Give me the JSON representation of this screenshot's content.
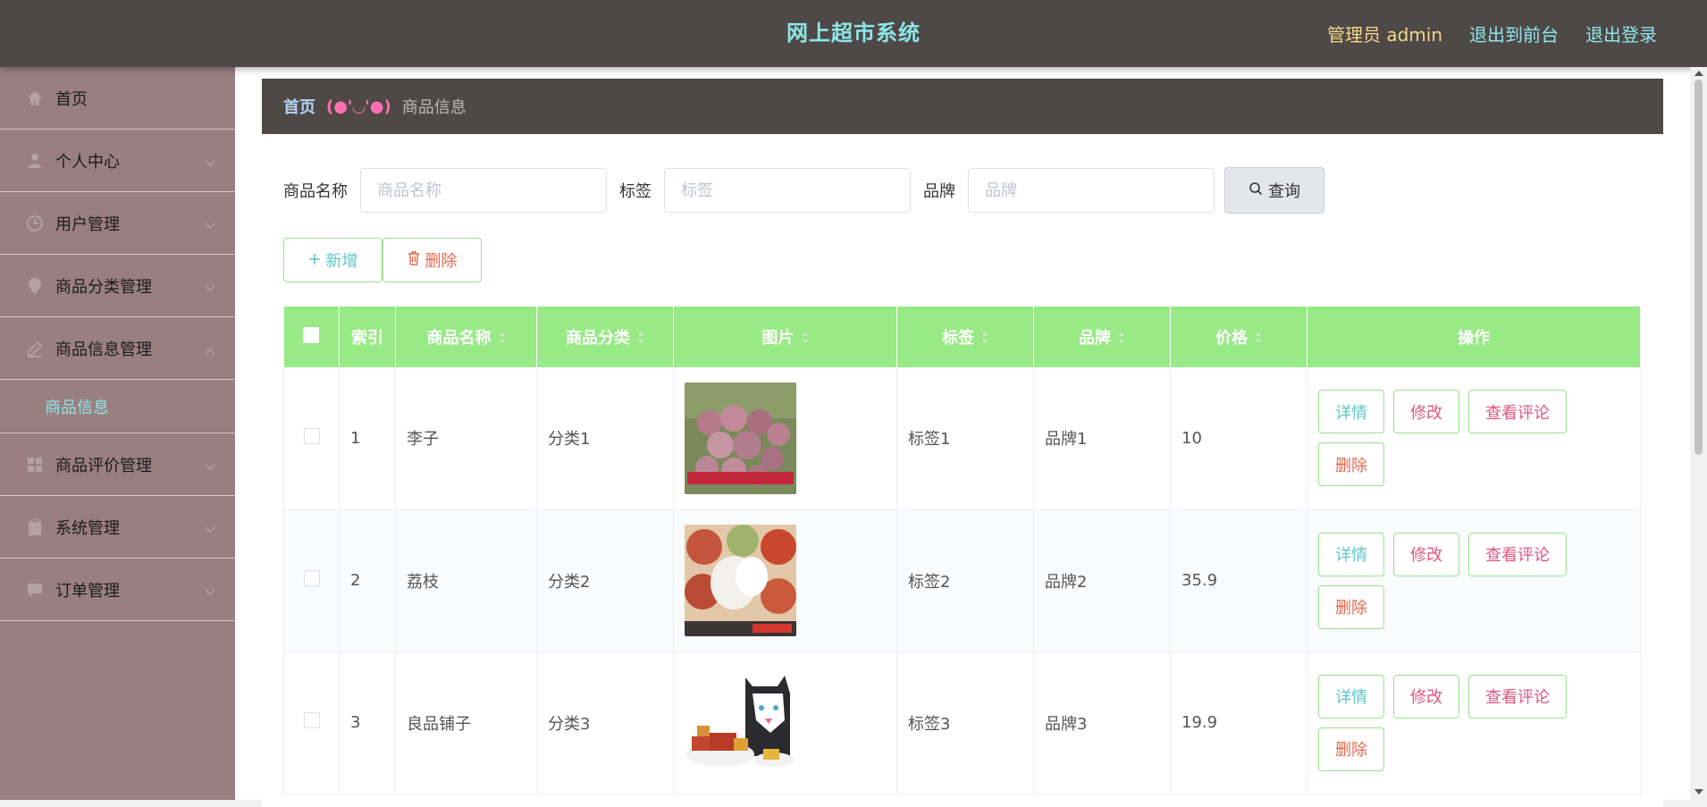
{
  "header": {
    "title": "网上超市系统",
    "admin_role": "管理员",
    "admin_name": "admin",
    "link_frontend": "退出到前台",
    "link_logout": "退出登录"
  },
  "sidebar": {
    "items": [
      {
        "label": "首页",
        "icon": "home-icon"
      },
      {
        "label": "个人中心",
        "icon": "user-icon"
      },
      {
        "label": "用户管理",
        "icon": "clock-icon"
      },
      {
        "label": "商品分类管理",
        "icon": "pin-icon"
      },
      {
        "label": "商品信息管理",
        "icon": "edit-icon",
        "expanded": true
      },
      {
        "label": "商品评价管理",
        "icon": "grid-icon"
      },
      {
        "label": "系统管理",
        "icon": "clipboard-icon"
      },
      {
        "label": "订单管理",
        "icon": "chat-icon"
      }
    ],
    "submenu_active": "商品信息"
  },
  "breadcrumb": {
    "home": "首页",
    "face": "(●'◡'●)",
    "current": "商品信息"
  },
  "search": {
    "name_label": "商品名称",
    "name_placeholder": "商品名称",
    "tag_label": "标签",
    "tag_placeholder": "标签",
    "brand_label": "品牌",
    "brand_placeholder": "品牌",
    "query_label": "查询"
  },
  "actions": {
    "add_label": "新增",
    "delete_label": "删除"
  },
  "table": {
    "columns": [
      "索引",
      "商品名称",
      "商品分类",
      "图片",
      "标签",
      "品牌",
      "价格",
      "操作"
    ],
    "rows": [
      {
        "index": "1",
        "name": "李子",
        "category": "分类1",
        "image": "plum-photo",
        "tag": "标签1",
        "brand": "品牌1",
        "price": "10"
      },
      {
        "index": "2",
        "name": "荔枝",
        "category": "分类2",
        "image": "lychee-photo",
        "tag": "标签2",
        "brand": "品牌2",
        "price": "35.9"
      },
      {
        "index": "3",
        "name": "良品铺子",
        "category": "分类3",
        "image": "snack-bag-photo",
        "tag": "标签3",
        "brand": "品牌3",
        "price": "19.9"
      }
    ],
    "op_labels": {
      "detail": "详情",
      "edit": "修改",
      "review": "查看评论",
      "delete": "删除"
    }
  },
  "colors": {
    "topbar": "#4e4847",
    "sidebar": "#9a7f80",
    "accent_cyan": "#8ee6e8",
    "table_header": "#98ea86",
    "button_border": "#98e08e"
  }
}
